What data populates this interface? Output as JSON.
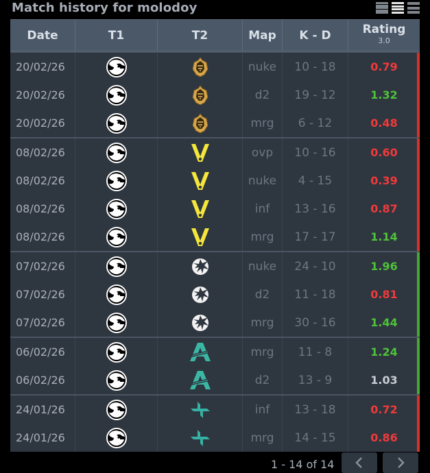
{
  "title": "Match history for molodoy",
  "headers": {
    "date": "Date",
    "t1": "T1",
    "t2": "T2",
    "map": "Map",
    "kd": "K - D",
    "rating": "Rating",
    "rating_sub": "3.0"
  },
  "colors": {
    "good": "#4fc23a",
    "bad": "#f03a3a",
    "neutral": "#c9ced4"
  },
  "groups": [
    {
      "result": "loss",
      "bar": "#d8342c",
      "opponent_icon": "gold-badge-icon",
      "rows": [
        {
          "date": "20/02/26",
          "map": "nuke",
          "kd": "10 - 18",
          "rating": "0.79",
          "tone": "bad"
        },
        {
          "date": "20/02/26",
          "map": "d2",
          "kd": "19 - 12",
          "rating": "1.32",
          "tone": "good"
        },
        {
          "date": "20/02/26",
          "map": "mrg",
          "kd": "6 - 12",
          "rating": "0.48",
          "tone": "bad"
        }
      ]
    },
    {
      "result": "loss",
      "bar": "#d8342c",
      "opponent_icon": "vitality-bee-icon",
      "rows": [
        {
          "date": "08/02/26",
          "map": "ovp",
          "kd": "10 - 16",
          "rating": "0.60",
          "tone": "bad"
        },
        {
          "date": "08/02/26",
          "map": "nuke",
          "kd": "4 - 15",
          "rating": "0.39",
          "tone": "bad"
        },
        {
          "date": "08/02/26",
          "map": "inf",
          "kd": "13 - 16",
          "rating": "0.87",
          "tone": "bad"
        },
        {
          "date": "08/02/26",
          "map": "mrg",
          "kd": "17 - 17",
          "rating": "1.14",
          "tone": "good"
        }
      ]
    },
    {
      "result": "win",
      "bar": "#4aa832",
      "opponent_icon": "spirit-dragon-icon",
      "rows": [
        {
          "date": "07/02/26",
          "map": "nuke",
          "kd": "24 - 10",
          "rating": "1.96",
          "tone": "good"
        },
        {
          "date": "07/02/26",
          "map": "d2",
          "kd": "11 - 18",
          "rating": "0.81",
          "tone": "bad"
        },
        {
          "date": "07/02/26",
          "map": "mrg",
          "kd": "30 - 16",
          "rating": "1.44",
          "tone": "good"
        }
      ]
    },
    {
      "result": "win",
      "bar": "#4aa832",
      "opponent_icon": "aurora-logo-icon",
      "rows": [
        {
          "date": "06/02/26",
          "map": "mrg",
          "kd": "11 - 8",
          "rating": "1.24",
          "tone": "good"
        },
        {
          "date": "06/02/26",
          "map": "d2",
          "kd": "13 - 9",
          "rating": "1.03",
          "tone": "neutral"
        }
      ]
    },
    {
      "result": "loss",
      "bar": "#d8342c",
      "opponent_icon": "teal-arrows-icon",
      "rows": [
        {
          "date": "24/01/26",
          "map": "inf",
          "kd": "13 - 18",
          "rating": "0.72",
          "tone": "bad"
        },
        {
          "date": "24/01/26",
          "map": "mrg",
          "kd": "14 - 15",
          "rating": "0.86",
          "tone": "bad"
        }
      ]
    }
  ],
  "team1_icon": "furia-panther-icon",
  "pagination": {
    "label": "1 - 14 of 14"
  }
}
